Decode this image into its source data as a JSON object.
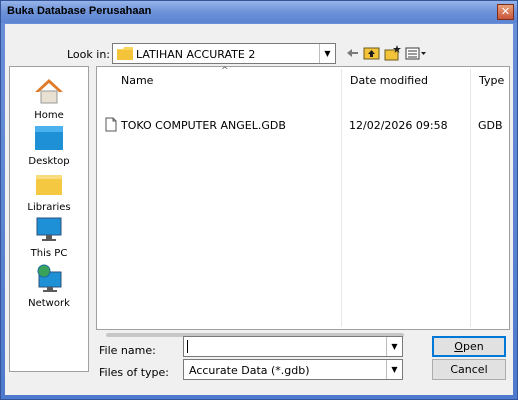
{
  "dialog": {
    "title": "Buka Database Perusahaan",
    "close_glyph": "✕"
  },
  "lookin": {
    "label": "Look in:",
    "value": "LATIHAN ACCURATE 2"
  },
  "toolbar": {
    "icons": [
      "back-arrow-icon",
      "up-folder-icon",
      "new-folder-icon",
      "view-menu-icon"
    ]
  },
  "places": [
    {
      "label": "Home",
      "icon": "home-icon"
    },
    {
      "label": "Desktop",
      "icon": "desktop-icon"
    },
    {
      "label": "Libraries",
      "icon": "libraries-icon"
    },
    {
      "label": "This PC",
      "icon": "this-pc-icon"
    },
    {
      "label": "Network",
      "icon": "network-icon"
    }
  ],
  "columns": {
    "name": "Name",
    "date": "Date modified",
    "type": "Type"
  },
  "files": [
    {
      "name": "TOKO COMPUTER ANGEL.GDB",
      "date": "12/02/2026 09:58",
      "type": "GDB Fi"
    }
  ],
  "filename": {
    "label": "File name:",
    "value": ""
  },
  "filetype": {
    "label": "Files of type:",
    "value": "Accurate Data (*.gdb)"
  },
  "buttons": {
    "open_mnemonic": "O",
    "open_rest": "pen",
    "cancel": "Cancel"
  },
  "colors": {
    "title_gradient": "#6c92d9",
    "default_button_border": "#0078d7"
  }
}
